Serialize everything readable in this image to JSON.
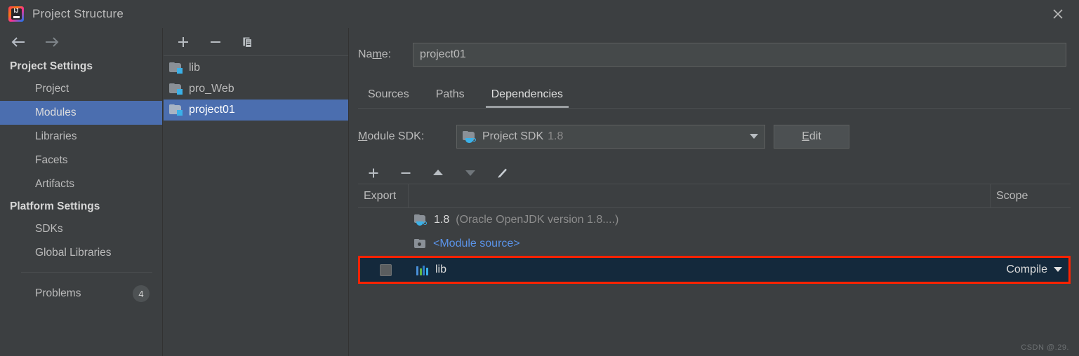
{
  "window": {
    "title": "Project Structure",
    "logo_icon": "intellij-idea-logo",
    "close_icon": "close-icon"
  },
  "sidebar": {
    "back_icon": "arrow-left-icon",
    "forward_icon": "arrow-right-icon",
    "groups": [
      {
        "title": "Project Settings",
        "items": [
          {
            "label": "Project",
            "selected": false
          },
          {
            "label": "Modules",
            "selected": true
          },
          {
            "label": "Libraries",
            "selected": false
          },
          {
            "label": "Facets",
            "selected": false
          },
          {
            "label": "Artifacts",
            "selected": false
          }
        ]
      },
      {
        "title": "Platform Settings",
        "items": [
          {
            "label": "SDKs",
            "selected": false
          },
          {
            "label": "Global Libraries",
            "selected": false
          }
        ]
      }
    ],
    "problems": {
      "label": "Problems",
      "count": "4"
    }
  },
  "modules_panel": {
    "toolbar": {
      "add_icon": "plus-icon",
      "remove_icon": "minus-icon",
      "copy_icon": "copy-icon"
    },
    "modules": [
      {
        "name": "lib",
        "icon": "module-folder-icon",
        "selected": false
      },
      {
        "name": "pro_Web",
        "icon": "module-folder-icon",
        "selected": false
      },
      {
        "name": "project01",
        "icon": "module-folder-icon",
        "selected": true
      }
    ]
  },
  "details": {
    "name_label_pre": "Na",
    "name_label_mnemonic": "m",
    "name_label_post": "e:",
    "name_value": "project01",
    "name_placeholder": "",
    "tabs": [
      {
        "label": "Sources",
        "active": false
      },
      {
        "label": "Paths",
        "active": false
      },
      {
        "label": "Dependencies",
        "active": true
      }
    ],
    "sdk": {
      "label_mnemonic": "M",
      "label_post": "odule SDK:",
      "icon": "sdk-folder-icon",
      "value": "Project SDK",
      "version": "1.8",
      "dropdown_icon": "chevron-down-icon",
      "edit_button_mnemonic": "E",
      "edit_button_post": "dit"
    },
    "dep_toolbar": {
      "add_icon": "plus-icon",
      "remove_icon": "minus-icon",
      "move_up_icon": "arrow-up-icon",
      "move_down_icon": "arrow-down-icon",
      "edit_icon": "pencil-icon"
    },
    "table": {
      "columns": [
        "Export",
        "",
        "Scope"
      ],
      "rows": [
        {
          "icon": "jdk-icon",
          "name": "1.8",
          "detail": "(Oracle OpenJDK version 1.8....)",
          "scope": "",
          "checkbox": false,
          "highlighted": false,
          "style": "white"
        },
        {
          "icon": "module-source-icon",
          "name": "<Module source>",
          "detail": "",
          "scope": "",
          "checkbox": false,
          "highlighted": false,
          "style": "blue"
        },
        {
          "icon": "library-icon",
          "name": "lib",
          "detail": "",
          "scope": "Compile",
          "scope_dropdown_icon": "chevron-down-icon",
          "checkbox": true,
          "highlighted": true,
          "style": "white"
        }
      ]
    }
  },
  "watermark": "CSDN @.29.",
  "colors": {
    "background": "#3c3f41",
    "selection_blue": "#4b6eaf",
    "highlight_border": "#ff2200",
    "highlight_row_bg": "#14293c",
    "accent_cyan": "#3bb1e8",
    "link_blue": "#5a93e8",
    "text": "#bbbbbb",
    "text_dim": "#8c8c8c"
  }
}
